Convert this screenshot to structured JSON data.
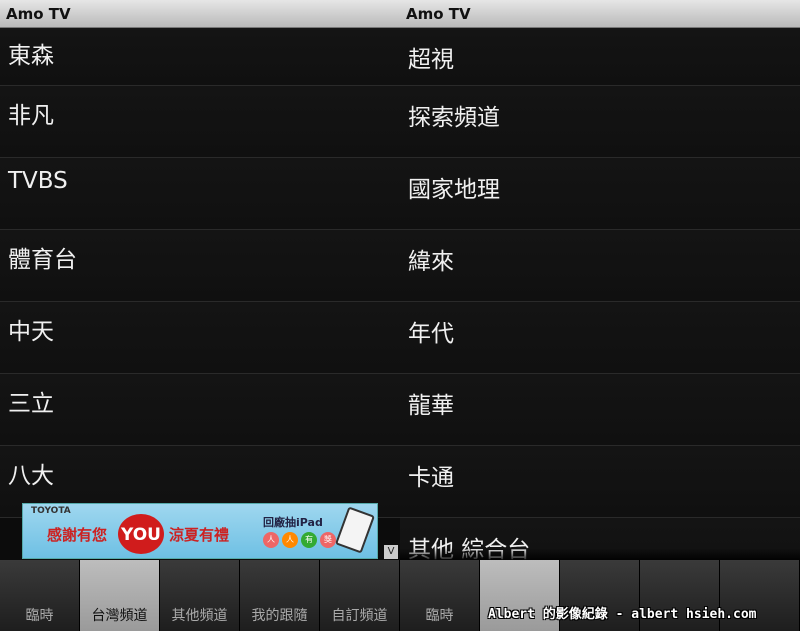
{
  "left": {
    "app_title": "Amo TV",
    "channels": [
      "東森",
      "非凡",
      "TVBS",
      "體育台",
      "中天",
      "三立",
      "八大"
    ],
    "ad": {
      "brand": "TOYOTA",
      "text1": "感謝有您",
      "badge": "YOU",
      "text2": "涼夏有禮",
      "promo": "回廠抽iPad",
      "dots": [
        "人",
        "人",
        "有",
        "獎"
      ],
      "close": "V"
    },
    "tabs": [
      "臨時",
      "台灣頻道",
      "其他頻道",
      "我的跟隨",
      "自訂頻道"
    ],
    "active_tab": 1
  },
  "right": {
    "app_title": "Amo TV",
    "channels": [
      "超視",
      "探索頻道",
      "國家地理",
      "緯來",
      "年代",
      "龍華",
      "卡通",
      "其他 綜合台"
    ],
    "tabs": [
      "臨時",
      "",
      "",
      "",
      ""
    ],
    "active_tab": 1
  },
  "watermark": "Albert 的影像紀錄 - albert hsieh.com"
}
